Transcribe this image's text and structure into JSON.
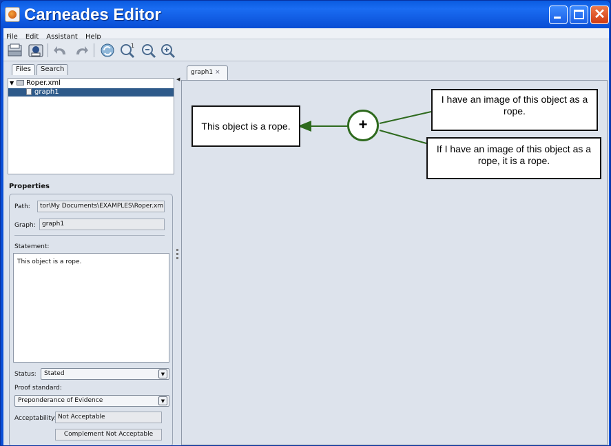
{
  "window": {
    "title": "Carneades Editor"
  },
  "menu": [
    "File",
    "Edit",
    "Assistant",
    "Help"
  ],
  "toolbar": {
    "buttons": [
      "open-icon",
      "save-icon",
      "undo-icon",
      "redo-icon",
      "refresh-icon",
      "zoom-reset-icon",
      "zoom-out-icon",
      "zoom-in-icon"
    ]
  },
  "left_tabs": [
    "Files",
    "Search"
  ],
  "tree": {
    "root": "Roper.xml",
    "child": "graph1"
  },
  "properties": {
    "title": "Properties",
    "path_label": "Path:",
    "path_value": "tor\\My Documents\\EXAMPLES\\Roper.xml",
    "graph_label": "Graph:",
    "graph_value": "graph1",
    "statement_label": "Statement:",
    "statement_value": "This object is a rope.",
    "status_label": "Status:",
    "status_value": "Stated",
    "proof_label": "Proof standard:",
    "proof_value": "Preponderance of Evidence",
    "acceptability_label": "Acceptability:",
    "acceptability_value": "Not Acceptable",
    "complement_value": "Complement Not Acceptable"
  },
  "graph": {
    "tab_label": "graph1",
    "tab_close": "×",
    "conclusion": "This object is a rope.",
    "argument_symbol": "+",
    "premise_1": "I have an image of this object as a rope.",
    "premise_2": "If I have an image of this object as a rope, it is a rope.",
    "edge_color": "#2e6a1e"
  }
}
